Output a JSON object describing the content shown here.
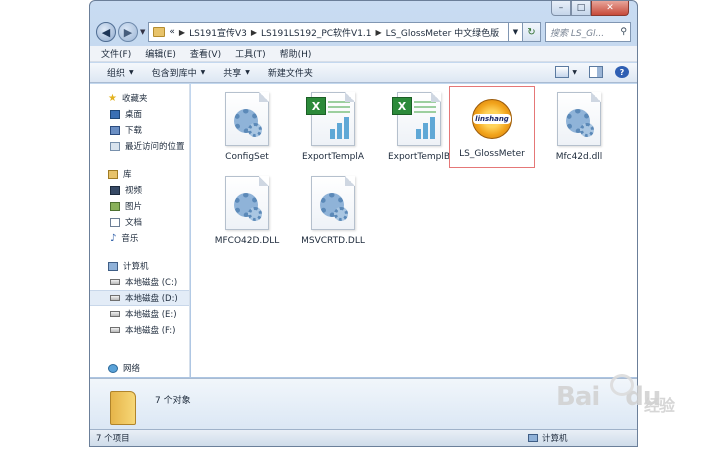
{
  "window": {
    "caption_buttons": {
      "minimize": "–",
      "maximize": "□",
      "close": "✕"
    }
  },
  "address_bar": {
    "prefix": "«",
    "crumbs": [
      "LS191宣传V3",
      "LS191LS192_PC软件V1.1",
      "LS_GlossMeter 中文绿色版"
    ]
  },
  "search": {
    "placeholder": "搜索 LS_Gl..."
  },
  "menu": [
    "文件(F)",
    "编辑(E)",
    "查看(V)",
    "工具(T)",
    "帮助(H)"
  ],
  "toolbar": {
    "organize": "组织",
    "include_library": "包含到库中",
    "share": "共享",
    "new_folder": "新建文件夹"
  },
  "nav": {
    "favorites": {
      "label": "收藏夹",
      "items": [
        "桌面",
        "下载",
        "最近访问的位置"
      ]
    },
    "libraries": {
      "label": "库",
      "items": [
        "视频",
        "图片",
        "文档",
        "音乐"
      ]
    },
    "computer": {
      "label": "计算机",
      "items": [
        "本地磁盘 (C:)",
        "本地磁盘 (D:)",
        "本地磁盘 (E:)",
        "本地磁盘 (F:)"
      ],
      "selected_index": 1
    },
    "network": {
      "label": "网络"
    }
  },
  "files": [
    {
      "name": "ConfigSet",
      "icon": "gear-file-icon"
    },
    {
      "name": "ExportTemplA",
      "icon": "excel-file-icon"
    },
    {
      "name": "ExportTemplB",
      "icon": "excel-file-icon"
    },
    {
      "name": "LS_GlossMeter",
      "icon": "linshang-app-icon",
      "selected": true
    },
    {
      "name": "Mfc42d.dll",
      "icon": "gear-file-icon"
    },
    {
      "name": "MFCO42D.DLL",
      "icon": "gear-file-icon"
    },
    {
      "name": "MSVCRTD.DLL",
      "icon": "gear-file-icon"
    }
  ],
  "app_icon_text": "linshang",
  "details": {
    "count": "7 个对象"
  },
  "status": {
    "items": "7 个项目",
    "location": "计算机"
  },
  "watermark": {
    "brand": "Bai",
    "brand2": "du",
    "zh": "经验"
  }
}
